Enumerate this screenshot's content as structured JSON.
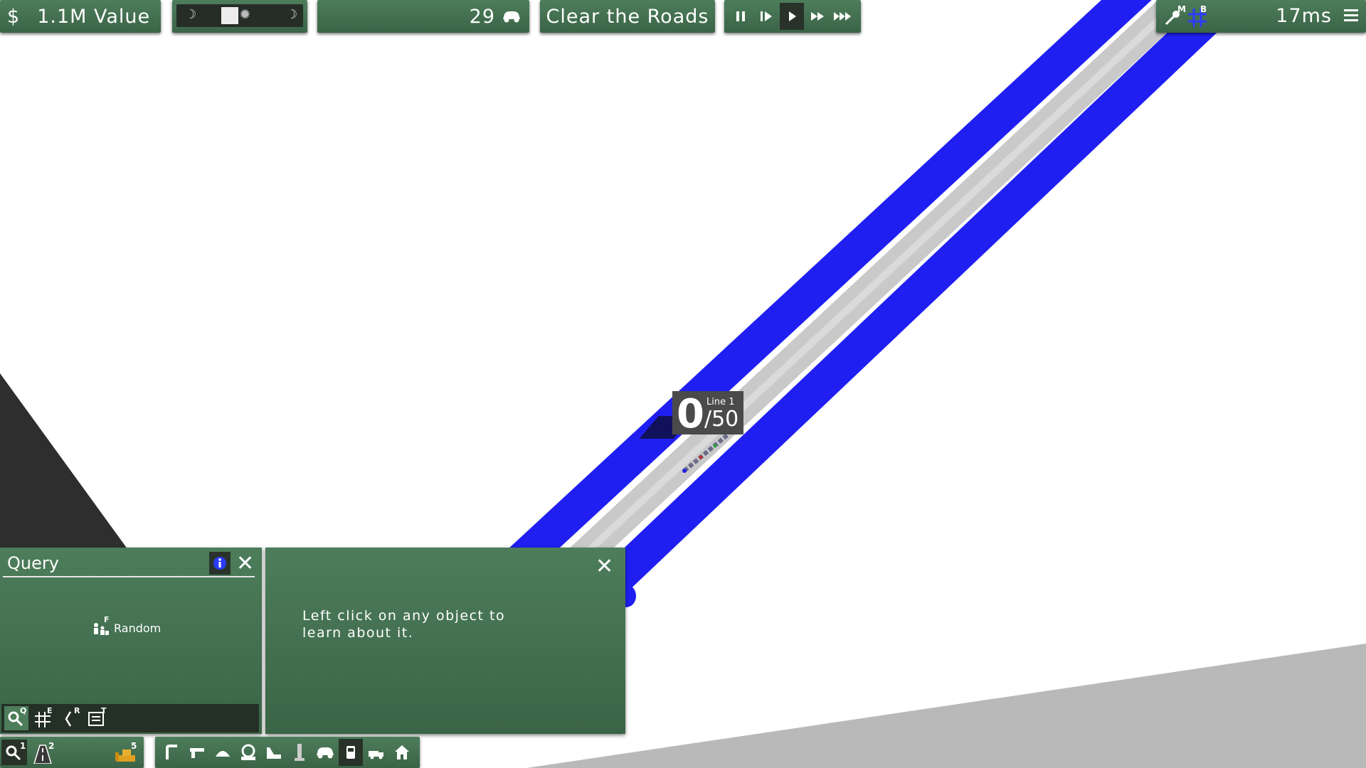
{
  "top_bar": {
    "money": {
      "currency_symbol": "$",
      "label": "1.1M Value"
    },
    "time_of_day": {
      "moon_left_icon": "moon-icon",
      "sun_icon": "sun-icon",
      "moon_right_icon": "moon-icon"
    },
    "vehicle_count": {
      "value": "29",
      "icon": "car-icon"
    },
    "challenge": {
      "label": "Clear the Roads"
    },
    "speed_controls": {
      "buttons": [
        "pause-icon",
        "step-icon",
        "play-icon",
        "fast-forward-icon",
        "fastest-forward-icon"
      ],
      "selected": "play-icon"
    },
    "right": {
      "map_hotkey": "M",
      "blueprint_hotkey": "B",
      "frame_time": "17ms",
      "menu_icon": "hamburger-icon"
    }
  },
  "map": {
    "transit_counter": {
      "count": "0",
      "line_label": "Line 1",
      "capacity": "/50"
    },
    "road_color": "#1f1ff2",
    "rail_color": "#c8c8c8"
  },
  "query_panel": {
    "title": "Query",
    "random_label": "Random",
    "random_hotkey": "F",
    "tools": [
      {
        "icon": "magnifier-icon",
        "hotkey": "Q"
      },
      {
        "icon": "grid-icon",
        "hotkey": "E"
      },
      {
        "icon": "route-icon",
        "hotkey": "R"
      },
      {
        "icon": "list-icon",
        "hotkey": "T"
      }
    ]
  },
  "info_panel": {
    "message_line1": "Left click on any object to",
    "message_line2": "learn about it."
  },
  "bottom_toolbar": {
    "left": [
      {
        "icon": "query-icon",
        "hotkey": "1"
      },
      {
        "icon": "road-icon",
        "hotkey": "2"
      },
      {
        "icon": "bulldozer-icon",
        "hotkey": "5"
      }
    ],
    "build": [
      "road-pipe-icon",
      "gun-icon",
      "dome-icon",
      "hand-icon",
      "slide-icon",
      "tower-icon",
      "car-icon",
      "bus-icon",
      "truck-icon",
      "house-icon"
    ]
  },
  "colors": {
    "panel": "#436e4f",
    "accent_blue": "#2b3cff"
  }
}
